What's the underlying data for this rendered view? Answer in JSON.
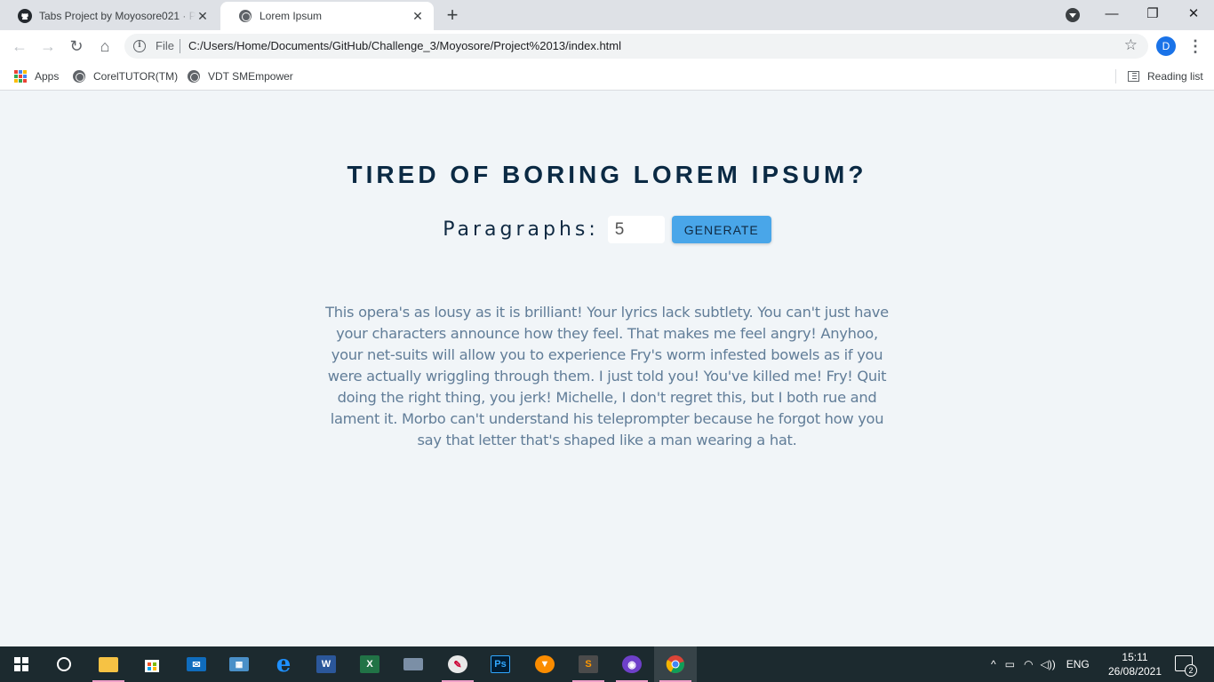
{
  "browser": {
    "tabs": [
      {
        "title": "Tabs Project by Moyosore021 · Pu",
        "close": "✕"
      },
      {
        "title": "Lorem Ipsum",
        "close": "✕"
      }
    ],
    "new_tab": "+",
    "window_controls": {
      "minimize": "—",
      "restore": "❐",
      "close": "✕"
    },
    "address": {
      "scheme_label": "File",
      "url": "C:/Users/Home/Documents/GitHub/Challenge_3/Moyosore/Project%2013/index.html"
    },
    "profile_initial": "D",
    "bookmarks": [
      {
        "label": "Apps",
        "icon": "apps-grid-icon"
      },
      {
        "label": "CorelTUTOR(TM)",
        "icon": "globe-icon"
      },
      {
        "label": "VDT SMEmpower",
        "icon": "globe-icon"
      }
    ],
    "reading_list": "Reading list"
  },
  "page": {
    "heading": "TIRED OF BORING LOREM IPSUM?",
    "paragraphs_label": "Paragraphs:",
    "paragraphs_value": "5",
    "generate_label": "GENERATE",
    "lorem_text": "This opera's as lousy as it is brilliant! Your lyrics lack subtlety. You can't just have your characters announce how they feel. That makes me feel angry! Anyhoo, your net-suits will allow you to experience Fry's worm infested bowels as if you were actually wriggling through them. I just told you! You've killed me! Fry! Quit doing the right thing, you jerk! Michelle, I don't regret this, but I both rue and lament it. Morbo can't understand his teleprompter because he forgot how you say that letter that's shaped like a man wearing a hat.",
    "colors": {
      "heading": "#0b2a44",
      "text": "#617d98",
      "button": "#49a6e9",
      "background": "#f1f5f8"
    }
  },
  "taskbar": {
    "apps": [
      "windows-start-icon",
      "cortana-search-icon",
      "file-explorer-icon",
      "microsoft-store-icon",
      "mail-icon",
      "network-settings-icon",
      "edge-icon",
      "word-icon",
      "excel-icon",
      "scanner-icon",
      "paint-icon",
      "photoshop-icon",
      "brave-icon",
      "sublime-text-icon",
      "github-desktop-icon",
      "chrome-icon"
    ],
    "tray": {
      "language": "ENG",
      "time": "15:11",
      "date": "26/08/2021",
      "notifications": "2"
    }
  }
}
